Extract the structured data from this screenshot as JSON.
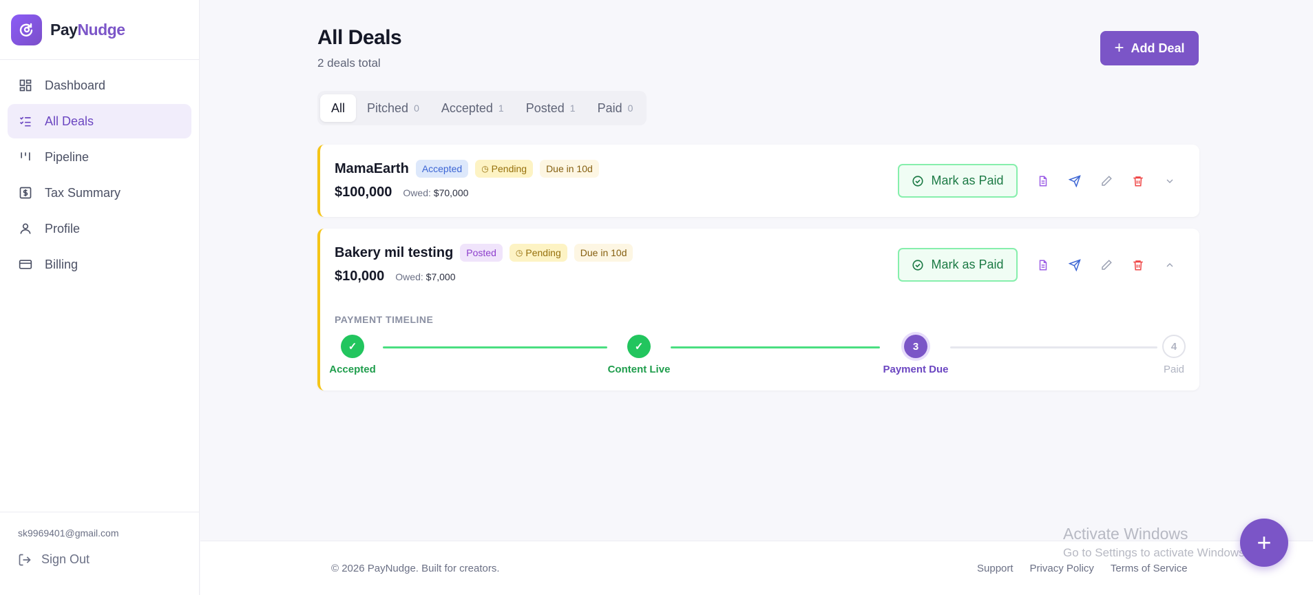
{
  "brand": {
    "part1": "Pay",
    "part2": "Nudge"
  },
  "sidebar": {
    "items": [
      {
        "label": "Dashboard",
        "icon": "dashboard-icon"
      },
      {
        "label": "All Deals",
        "icon": "list-check-icon",
        "active": true
      },
      {
        "label": "Pipeline",
        "icon": "kanban-icon"
      },
      {
        "label": "Tax Summary",
        "icon": "receipt-icon"
      },
      {
        "label": "Profile",
        "icon": "user-icon"
      },
      {
        "label": "Billing",
        "icon": "credit-card-icon"
      }
    ],
    "email": "sk9969401@gmail.com",
    "signout": "Sign Out"
  },
  "header": {
    "title": "All Deals",
    "subtitle": "2 deals total",
    "add_label": "Add Deal"
  },
  "tabs": [
    {
      "label": "All",
      "count": ""
    },
    {
      "label": "Pitched",
      "count": "0"
    },
    {
      "label": "Accepted",
      "count": "1"
    },
    {
      "label": "Posted",
      "count": "1"
    },
    {
      "label": "Paid",
      "count": "0"
    }
  ],
  "deals": [
    {
      "name": "MamaEarth",
      "status": "Accepted",
      "payment": "Pending",
      "due": "Due in 10d",
      "amount": "$100,000",
      "owed_label": "Owed:",
      "owed": "$70,000",
      "action": "Mark as Paid"
    },
    {
      "name": "Bakery mil testing",
      "status": "Posted",
      "payment": "Pending",
      "due": "Due in 10d",
      "amount": "$10,000",
      "owed_label": "Owed:",
      "owed": "$7,000",
      "action": "Mark as Paid"
    }
  ],
  "timeline": {
    "label": "PAYMENT TIMELINE",
    "steps": [
      {
        "label": "Accepted",
        "marker": "✓",
        "state": "done"
      },
      {
        "label": "Content Live",
        "marker": "✓",
        "state": "done"
      },
      {
        "label": "Payment Due",
        "marker": "3",
        "state": "current"
      },
      {
        "label": "Paid",
        "marker": "4",
        "state": "todo"
      }
    ]
  },
  "footer": {
    "copyright": "© 2026 PayNudge. Built for creators.",
    "links": [
      "Support",
      "Privacy Policy",
      "Terms of Service"
    ]
  },
  "watermark": {
    "line1": "Activate Windows",
    "line2": "Go to Settings to activate Windows."
  },
  "fab": {
    "label": "+"
  },
  "colors": {
    "accent": "#7b55c7",
    "card_border": "#f5c518",
    "success": "#22c55e"
  }
}
